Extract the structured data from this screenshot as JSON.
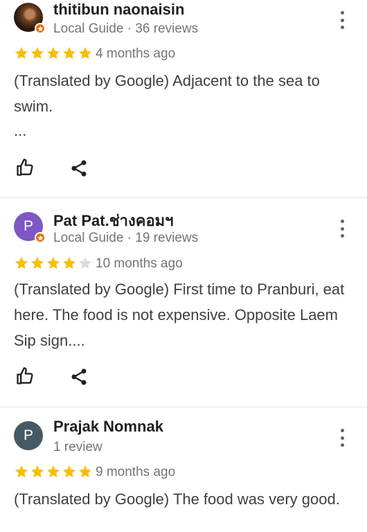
{
  "reviews": [
    {
      "author": "thitibun naonaisin",
      "meta": "Local Guide · 36 reviews",
      "rating": 5,
      "time": "4 months ago",
      "text": "(Translated by Google) Adjacent to the sea to swim.",
      "ellipsis": "...",
      "avatar_icon": "user-photo-avatar",
      "badge_icon": "local-guide-star-badge"
    },
    {
      "author": "Pat Pat.ช่างคอมฯ",
      "meta": "Local Guide · 19 reviews",
      "rating": 4,
      "time": "10 months ago",
      "text": "(Translated by Google) First time to Pranburi, eat here. The food is not expensive. Opposite Laem Sip sign....",
      "avatar_letter": "P",
      "avatar_color": "#7e57c2",
      "badge_icon": "local-guide-star-badge"
    },
    {
      "author": "Prajak Nomnak",
      "meta": "1 review",
      "rating": 5,
      "time": "9 months ago",
      "text": "(Translated by Google) The food was very good.",
      "avatar_letter": "P",
      "avatar_color": "#455a64"
    }
  ],
  "colors": {
    "star_filled": "#fbbc04",
    "star_empty": "#dadce0",
    "badge": "#e8710a",
    "secondary_text": "#70757a"
  },
  "icons": [
    "more-vert-icon",
    "thumbs-up-icon",
    "share-icon",
    "star-icon"
  ]
}
